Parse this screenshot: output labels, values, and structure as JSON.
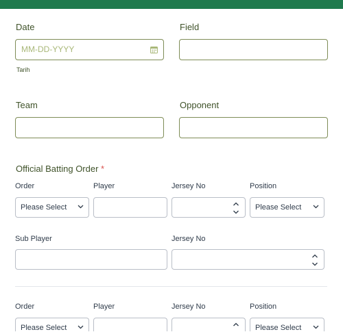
{
  "colors": {
    "brand": "#1f7a4d",
    "field_border": "#7e8c56",
    "label": "#3f5229",
    "required": "#d9534f"
  },
  "date": {
    "label": "Date",
    "placeholder": "MM-DD-YYYY",
    "sublabel": "Tarih",
    "icon": "calendar-icon"
  },
  "field": {
    "label": "Field"
  },
  "team": {
    "label": "Team"
  },
  "opponent": {
    "label": "Opponent"
  },
  "batting": {
    "title": "Official Batting Order",
    "required_mark": "*",
    "rows": [
      {
        "order_label": "Order",
        "order_value": "Please Select",
        "player_label": "Player",
        "jersey_label": "Jersey No",
        "position_label": "Position",
        "position_value": "Please Select"
      },
      {
        "order_label": "Order",
        "order_value": "Please Select",
        "player_label": "Player",
        "jersey_label": "Jersey No",
        "position_label": "Position",
        "position_value": "Please Select"
      }
    ],
    "sub_player": {
      "label": "Sub Player",
      "jersey_label": "Jersey No"
    }
  }
}
